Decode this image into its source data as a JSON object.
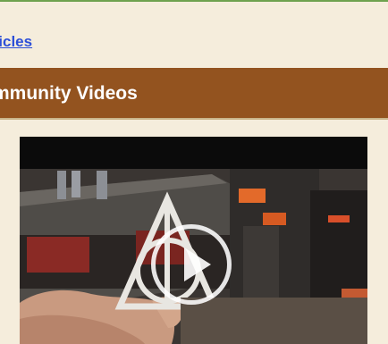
{
  "articles_link": {
    "label": "rticles"
  },
  "community_videos": {
    "title": "mmunity Videos",
    "video": {
      "play_icon": "play-icon"
    }
  },
  "colors": {
    "page_background": "#f5eddc",
    "header_background": "#93531f",
    "link": "#2d4fd8",
    "top_rule": "#6ea24f"
  }
}
